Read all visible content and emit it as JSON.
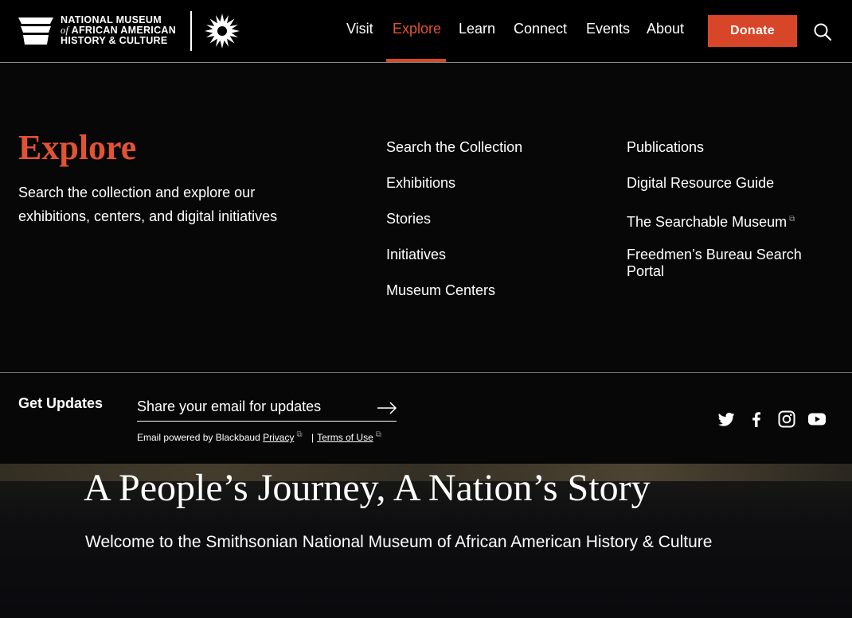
{
  "header": {
    "logo": {
      "line1": "NATIONAL MUSEUM",
      "line2_italic": "of",
      "line2": "AFRICAN AMERICAN",
      "line3": "HISTORY & CULTURE"
    },
    "nav": [
      {
        "label": "Visit",
        "active": false
      },
      {
        "label": "Explore",
        "active": true
      },
      {
        "label": "Learn",
        "active": false
      },
      {
        "label": "Connect",
        "active": false
      },
      {
        "label": "Events",
        "active": false
      },
      {
        "label": "About",
        "active": false
      }
    ],
    "donate_label": "Donate",
    "search_icon": "search-icon"
  },
  "mega": {
    "title": "Explore",
    "description": "Search the collection and explore our exhibitions, centers, and digital initiatives",
    "col1": [
      "Search the Collection",
      "Exhibitions",
      "Stories",
      "Initiatives",
      "Museum Centers"
    ],
    "col2": [
      "Publications",
      "Digital Resource Guide",
      "The Searchable Museum",
      "Freedmen’s Bureau Search",
      "Portal"
    ]
  },
  "updates": {
    "label": "Get Updates",
    "email_placeholder": "Share your email for updates",
    "powered_by": "Email powered by Blackbaud",
    "privacy": "Privacy",
    "separator": "|",
    "terms": "Terms of Use",
    "social": [
      "twitter-icon",
      "facebook-icon",
      "instagram-icon",
      "youtube-icon"
    ]
  },
  "hero": {
    "title": "A People’s Journey, A Nation’s Story",
    "subtitle": "Welcome to the Smithsonian National Museum of African American History & Culture"
  },
  "colors": {
    "accent": "#e15333",
    "donate": "#d8462a",
    "background": "#070707"
  }
}
